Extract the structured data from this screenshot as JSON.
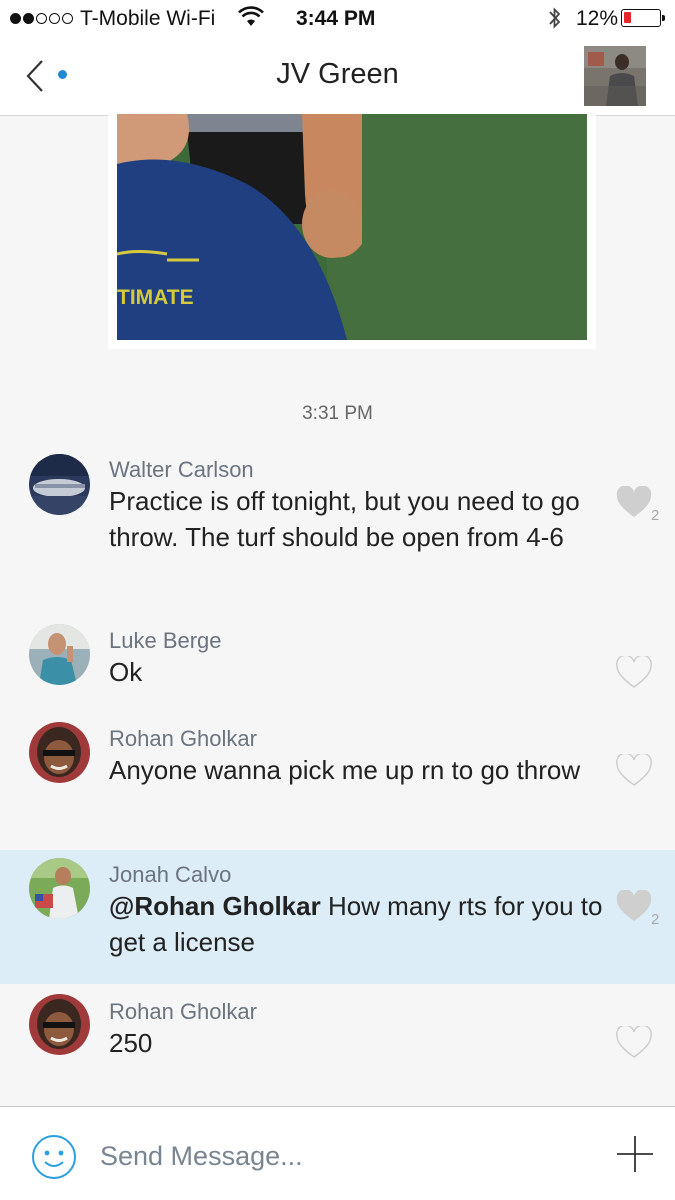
{
  "status_bar": {
    "carrier": "T-Mobile Wi-Fi",
    "time": "3:44 PM",
    "battery": "12%"
  },
  "header": {
    "title": "JV Green"
  },
  "feed": {
    "timestamp": "3:31 PM",
    "messages": [
      {
        "sender": "Walter Carlson",
        "text": "Practice is off tonight, but you need to go throw. The turf should be open from 4-6",
        "likes": "2",
        "liked": true
      },
      {
        "sender": "Luke Berge",
        "text": "Ok",
        "likes": "",
        "liked": false
      },
      {
        "sender": "Rohan Gholkar",
        "text": "Anyone wanna pick me up rn to go throw",
        "likes": "",
        "liked": false
      },
      {
        "sender": "Jonah Calvo",
        "mention": "@Rohan Gholkar",
        "text": " How many rts for you to get a license",
        "likes": "2",
        "liked": true
      },
      {
        "sender": "Rohan Gholkar",
        "text": "250",
        "likes": "",
        "liked": false
      }
    ]
  },
  "photo": {
    "shirt_text": "TIMATE"
  },
  "composer": {
    "placeholder": "Send Message..."
  },
  "colors": {
    "accent": "#1f8ad0",
    "highlight": "#dcedf7",
    "battery_low": "#e5262a"
  },
  "icons": [
    "back-chevron-icon",
    "wifi-icon",
    "bluetooth-icon",
    "battery-icon",
    "heart-icon",
    "smiley-icon",
    "plus-icon"
  ]
}
